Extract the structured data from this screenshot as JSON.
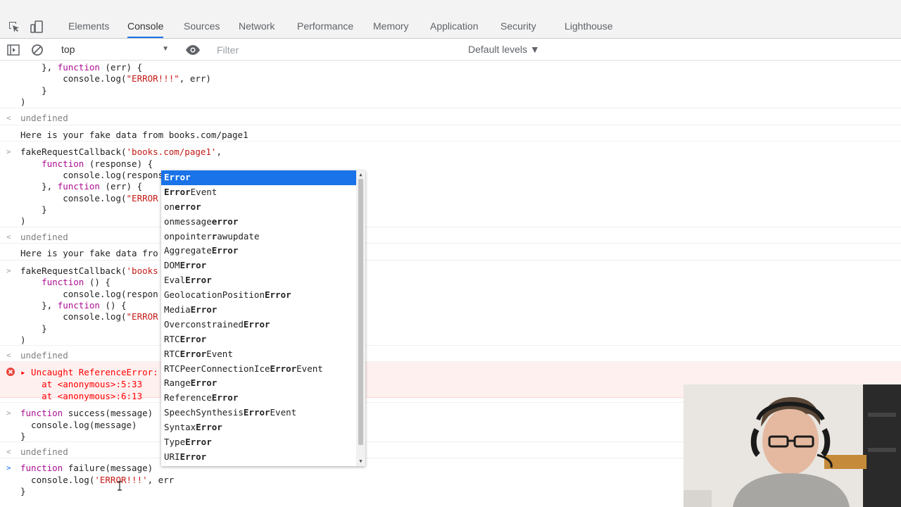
{
  "tabs": [
    {
      "label": "Elements"
    },
    {
      "label": "Console"
    },
    {
      "label": "Sources"
    },
    {
      "label": "Network"
    },
    {
      "label": "Performance"
    },
    {
      "label": "Memory"
    },
    {
      "label": "Application"
    },
    {
      "label": "Security"
    },
    {
      "label": "Lighthouse"
    }
  ],
  "toolbar": {
    "context": "top",
    "filter_placeholder": "Filter",
    "levels": "Default levels ▼"
  },
  "console": {
    "lines": [
      {
        "pfx": "",
        "parts": [
          {
            "t": "    }, ",
            "c": ""
          },
          {
            "t": "function",
            "c": "kw"
          },
          {
            "t": " (err) {",
            "c": ""
          }
        ]
      },
      {
        "pfx": "",
        "parts": [
          {
            "t": "        console.log(",
            "c": ""
          },
          {
            "t": "\"ERROR!!!\"",
            "c": "str"
          },
          {
            "t": ", err)",
            "c": ""
          }
        ]
      },
      {
        "pfx": "",
        "parts": [
          {
            "t": "    }",
            "c": ""
          }
        ]
      },
      {
        "pfx": "",
        "parts": [
          {
            "t": ")",
            "c": ""
          }
        ]
      },
      {
        "pfx": "<",
        "parts": [
          {
            "t": "undefined",
            "c": "dim"
          }
        ]
      },
      {
        "pfx": "",
        "parts": [
          {
            "t": "Here is your fake data from books.com/page1",
            "c": ""
          }
        ]
      },
      {
        "pfx": ">",
        "parts": [
          {
            "t": "fakeRequestCallback(",
            "c": ""
          },
          {
            "t": "'books.com/page1'",
            "c": "str"
          },
          {
            "t": ",",
            "c": ""
          }
        ]
      },
      {
        "pfx": "",
        "parts": [
          {
            "t": "    ",
            "c": ""
          },
          {
            "t": "function",
            "c": "kw"
          },
          {
            "t": " (response) {",
            "c": ""
          }
        ]
      },
      {
        "pfx": "",
        "parts": [
          {
            "t": "        console.log(response)",
            "c": ""
          }
        ]
      },
      {
        "pfx": "",
        "parts": [
          {
            "t": "    }, ",
            "c": ""
          },
          {
            "t": "function",
            "c": "kw"
          },
          {
            "t": " (err) {",
            "c": ""
          }
        ]
      },
      {
        "pfx": "",
        "parts": [
          {
            "t": "        console.log(",
            "c": ""
          },
          {
            "t": "\"ERROR",
            "c": "str"
          }
        ]
      },
      {
        "pfx": "",
        "parts": [
          {
            "t": "    }",
            "c": ""
          }
        ]
      },
      {
        "pfx": "",
        "parts": [
          {
            "t": ")",
            "c": ""
          }
        ]
      },
      {
        "pfx": "<",
        "parts": [
          {
            "t": "undefined",
            "c": "dim"
          }
        ]
      },
      {
        "pfx": "",
        "parts": [
          {
            "t": "Here is your fake data fro",
            "c": ""
          }
        ]
      },
      {
        "pfx": ">",
        "parts": [
          {
            "t": "fakeRequestCallback(",
            "c": ""
          },
          {
            "t": "'books",
            "c": "str"
          }
        ]
      },
      {
        "pfx": "",
        "parts": [
          {
            "t": "    ",
            "c": ""
          },
          {
            "t": "function",
            "c": "kw"
          },
          {
            "t": " () {",
            "c": ""
          }
        ]
      },
      {
        "pfx": "",
        "parts": [
          {
            "t": "        console.log(respon",
            "c": ""
          }
        ]
      },
      {
        "pfx": "",
        "parts": [
          {
            "t": "    }, ",
            "c": ""
          },
          {
            "t": "function",
            "c": "kw"
          },
          {
            "t": " () {",
            "c": ""
          }
        ]
      },
      {
        "pfx": "",
        "parts": [
          {
            "t": "        console.log(",
            "c": ""
          },
          {
            "t": "\"ERROR",
            "c": "str"
          }
        ]
      },
      {
        "pfx": "",
        "parts": [
          {
            "t": "    }",
            "c": ""
          }
        ]
      },
      {
        "pfx": "",
        "parts": [
          {
            "t": ")",
            "c": ""
          }
        ]
      },
      {
        "pfx": "<",
        "parts": [
          {
            "t": "undefined",
            "c": "dim"
          }
        ]
      },
      {
        "pfx": "err",
        "parts": [
          {
            "t": "▸ Uncaught ReferenceError:",
            "c": "errtxt"
          }
        ]
      },
      {
        "pfx": "",
        "parts": [
          {
            "t": "    at <anonymous>:5:33",
            "c": "errtxt"
          }
        ]
      },
      {
        "pfx": "",
        "parts": [
          {
            "t": "    at <anonymous>:6:13",
            "c": "errtxt"
          }
        ]
      },
      {
        "pfx": ">",
        "parts": [
          {
            "t": "function",
            "c": "kw"
          },
          {
            "t": " success(message)",
            "c": ""
          }
        ]
      },
      {
        "pfx": "",
        "parts": [
          {
            "t": "  console.log(message)",
            "c": ""
          }
        ]
      },
      {
        "pfx": "",
        "parts": [
          {
            "t": "}",
            "c": ""
          }
        ]
      },
      {
        "pfx": "<",
        "parts": [
          {
            "t": "undefined",
            "c": "dim"
          }
        ]
      },
      {
        "pfx": ">",
        "parts": [
          {
            "t": "function",
            "c": "kw"
          },
          {
            "t": " failure(message)",
            "c": ""
          }
        ]
      },
      {
        "pfx": "",
        "parts": [
          {
            "t": "  console.log(",
            "c": ""
          },
          {
            "t": "'ERROR!!!'",
            "c": "str"
          },
          {
            "t": ", err",
            "c": ""
          }
        ]
      },
      {
        "pfx": "",
        "parts": [
          {
            "t": "}",
            "c": ""
          }
        ]
      }
    ]
  },
  "autocomplete": {
    "items": [
      {
        "parts": [
          {
            "t": "Error",
            "b": true
          }
        ]
      },
      {
        "parts": [
          {
            "t": "Error",
            "b": true
          },
          {
            "t": "Event",
            "b": false
          }
        ]
      },
      {
        "parts": [
          {
            "t": "on",
            "b": false
          },
          {
            "t": "error",
            "b": true
          }
        ]
      },
      {
        "parts": [
          {
            "t": "onmessage",
            "b": false
          },
          {
            "t": "error",
            "b": true
          }
        ]
      },
      {
        "parts": [
          {
            "t": "onpointer",
            "b": false
          },
          {
            "t": "r",
            "b": true
          },
          {
            "t": "awupdate",
            "b": false
          }
        ]
      },
      {
        "parts": [
          {
            "t": "Aggregate",
            "b": false
          },
          {
            "t": "Error",
            "b": true
          }
        ]
      },
      {
        "parts": [
          {
            "t": "DOM",
            "b": false
          },
          {
            "t": "Error",
            "b": true
          }
        ]
      },
      {
        "parts": [
          {
            "t": "Eval",
            "b": false
          },
          {
            "t": "Error",
            "b": true
          }
        ]
      },
      {
        "parts": [
          {
            "t": "GeolocationPosition",
            "b": false
          },
          {
            "t": "Error",
            "b": true
          }
        ]
      },
      {
        "parts": [
          {
            "t": "Media",
            "b": false
          },
          {
            "t": "Error",
            "b": true
          }
        ]
      },
      {
        "parts": [
          {
            "t": "Overconstrained",
            "b": false
          },
          {
            "t": "Error",
            "b": true
          }
        ]
      },
      {
        "parts": [
          {
            "t": "RTC",
            "b": false
          },
          {
            "t": "Error",
            "b": true
          }
        ]
      },
      {
        "parts": [
          {
            "t": "RTC",
            "b": false
          },
          {
            "t": "Error",
            "b": true
          },
          {
            "t": "Event",
            "b": false
          }
        ]
      },
      {
        "parts": [
          {
            "t": "RTCPeerConnectionIce",
            "b": false
          },
          {
            "t": "Error",
            "b": true
          },
          {
            "t": "Event",
            "b": false
          }
        ]
      },
      {
        "parts": [
          {
            "t": "Range",
            "b": false
          },
          {
            "t": "Error",
            "b": true
          }
        ]
      },
      {
        "parts": [
          {
            "t": "Reference",
            "b": false
          },
          {
            "t": "Error",
            "b": true
          }
        ]
      },
      {
        "parts": [
          {
            "t": "SpeechSynthesis",
            "b": false
          },
          {
            "t": "Error",
            "b": true
          },
          {
            "t": "Event",
            "b": false
          }
        ]
      },
      {
        "parts": [
          {
            "t": "Syntax",
            "b": false
          },
          {
            "t": "Error",
            "b": true
          }
        ]
      },
      {
        "parts": [
          {
            "t": "Type",
            "b": false
          },
          {
            "t": "Error",
            "b": true
          }
        ]
      },
      {
        "parts": [
          {
            "t": "URI",
            "b": false
          },
          {
            "t": "Error",
            "b": true
          }
        ]
      }
    ]
  },
  "colors": {
    "accent": "#1a73e8",
    "error": "#ff0000",
    "keyword": "#aa0d91",
    "string": "#c41a16"
  }
}
